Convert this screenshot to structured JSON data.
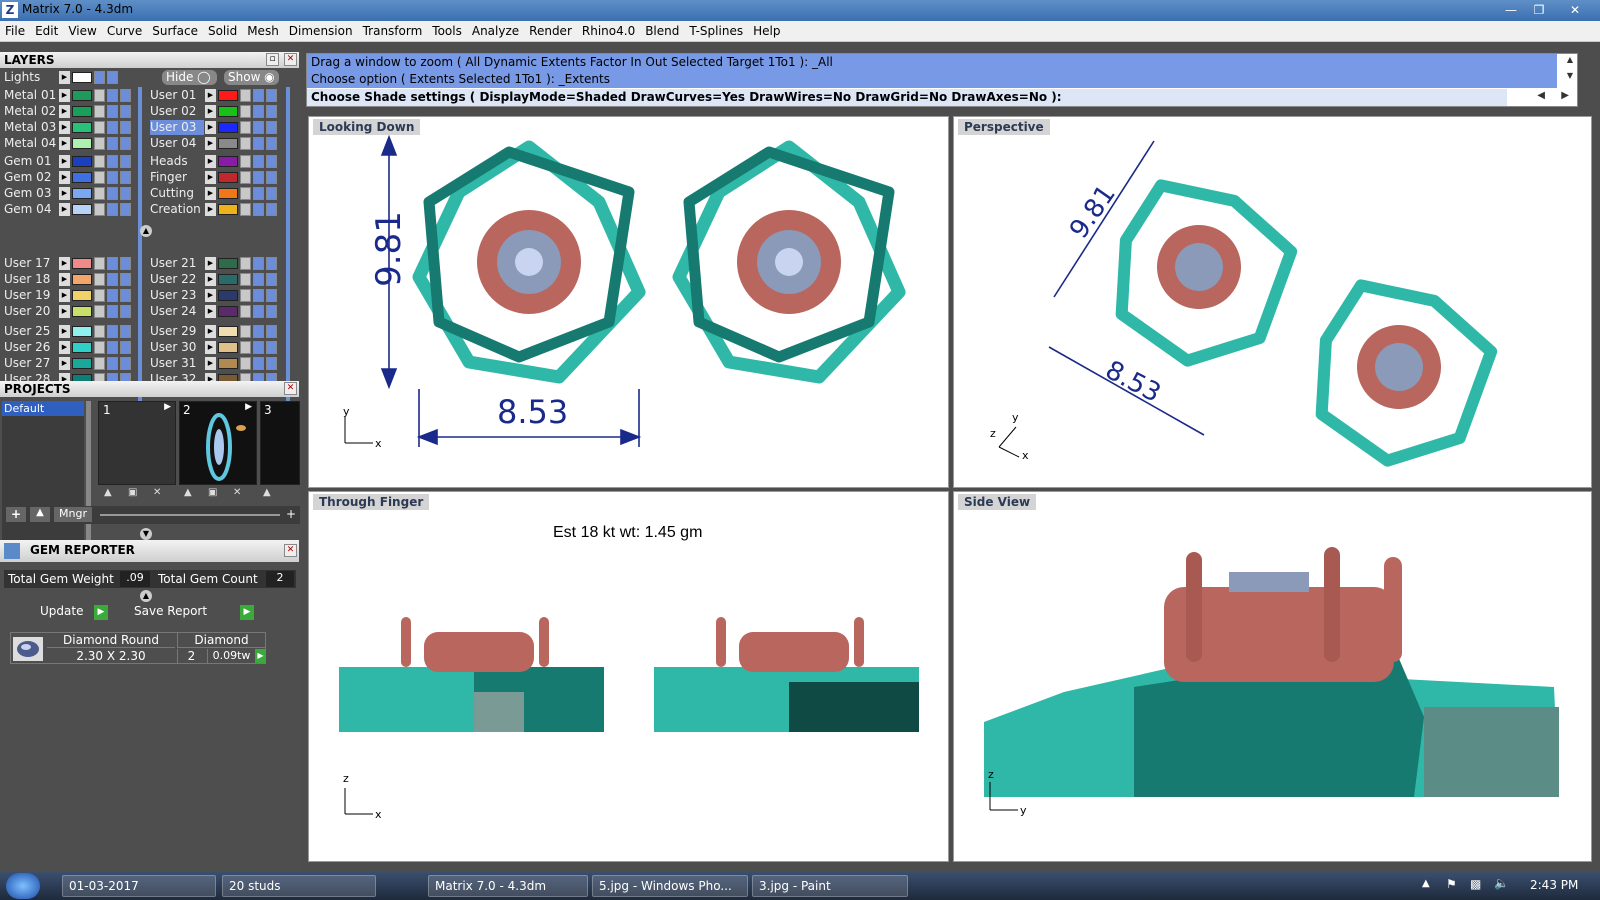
{
  "window": {
    "title": "Matrix 7.0 - 4.3dm",
    "icon_label": "Z"
  },
  "menu": [
    "File",
    "Edit",
    "View",
    "Curve",
    "Surface",
    "Solid",
    "Mesh",
    "Dimension",
    "Transform",
    "Tools",
    "Analyze",
    "Render",
    "Rhino4.0",
    "Blend",
    "T-Splines",
    "Help"
  ],
  "layers": {
    "title": "LAYERS",
    "lights": "Lights",
    "hide": "Hide",
    "show": "Show",
    "left": [
      {
        "label": "Metal 01",
        "color": "#1f9a5c"
      },
      {
        "label": "Metal 02",
        "color": "#1a9f5a"
      },
      {
        "label": "Metal 03",
        "color": "#29c07a"
      },
      {
        "label": "Metal 04",
        "color": "#aef0b0"
      },
      {
        "label": "Gem 01",
        "color": "#1a3fbf"
      },
      {
        "label": "Gem 02",
        "color": "#3f6fe0"
      },
      {
        "label": "Gem 03",
        "color": "#7aa8f0"
      },
      {
        "label": "Gem 04",
        "color": "#b9d3f7"
      },
      {
        "label": "User 17",
        "color": "#ef8a8a"
      },
      {
        "label": "User 18",
        "color": "#f2a66c"
      },
      {
        "label": "User 19",
        "color": "#efd36a"
      },
      {
        "label": "User 20",
        "color": "#c8e06a"
      },
      {
        "label": "User 25",
        "color": "#8ff0ee"
      },
      {
        "label": "User 26",
        "color": "#2fd0c8"
      },
      {
        "label": "User 27",
        "color": "#1aa89a"
      },
      {
        "label": "User 28",
        "color": "#0f7f76"
      }
    ],
    "right": [
      {
        "label": "User 01",
        "color": "#ff1a1a"
      },
      {
        "label": "User 02",
        "color": "#18c018"
      },
      {
        "label": "User 03",
        "color": "#1a2aff"
      },
      {
        "label": "User 04",
        "color": "#8a8a8a"
      },
      {
        "label": "Heads",
        "color": "#8a1aa8"
      },
      {
        "label": "Finger",
        "color": "#c0282d"
      },
      {
        "label": "Cutting",
        "color": "#f07818"
      },
      {
        "label": "Creation",
        "color": "#f0b21a"
      },
      {
        "label": "User 21",
        "color": "#2e6b4a"
      },
      {
        "label": "User 22",
        "color": "#2a6a6a"
      },
      {
        "label": "User 23",
        "color": "#2a3a6a"
      },
      {
        "label": "User 24",
        "color": "#5a2a6a"
      },
      {
        "label": "User 29",
        "color": "#f2ddb0"
      },
      {
        "label": "User 30",
        "color": "#e0c08a"
      },
      {
        "label": "User 31",
        "color": "#b08a50"
      },
      {
        "label": "User 32",
        "color": "#7a5a30"
      }
    ]
  },
  "projects": {
    "title": "PROJECTS",
    "default": "Default",
    "thumbs": [
      "1",
      "2",
      "3"
    ],
    "mngr": "Mngr"
  },
  "gem_reporter": {
    "title": "GEM REPORTER",
    "weight_label": "Total Gem Weight",
    "weight_value": ".09",
    "count_label": "Total Gem Count",
    "count_value": "2",
    "update": "Update",
    "save_report": "Save Report",
    "col1": "Diamond Round",
    "col2": "Diamond",
    "size": "2.30 X 2.30",
    "qty": "2",
    "tw": "0.09tw"
  },
  "command": {
    "line1": "Drag a window to zoom ( All  Dynamic  Extents  Factor  In  Out  Selected  Target  1To1 ): _All",
    "line2": "Choose option ( Extents  Selected  1To1 ): _Extents",
    "line3": "Choose Shade settings ( DisplayMode=Shaded  DrawCurves=Yes  DrawWires=No  DrawGrid=No  DrawAxes=No ):"
  },
  "viewports": {
    "top_left": {
      "label": "Looking Down",
      "dim_v": "9.81",
      "dim_h": "8.53",
      "axis_x": "x",
      "axis_y": "y"
    },
    "top_right": {
      "label": "Perspective",
      "dim_v": "9.81",
      "dim_h": "8.53",
      "axis_x": "x",
      "axis_y": "y",
      "axis_z": "z"
    },
    "bottom_left": {
      "label": "Through Finger",
      "note": "Est 18 kt wt: 1.45 gm",
      "axis_x": "x",
      "axis_z": "z"
    },
    "bottom_right": {
      "label": "Side View",
      "axis_y": "y",
      "axis_z": "z"
    }
  },
  "colors": {
    "teal": "#2fb8a8",
    "teal_dark": "#167a70",
    "gold": "#b8665e",
    "gem": "#8a9ab8",
    "dim_blue": "#1a2a8a",
    "layer_selected": "#6c8dd9"
  },
  "taskbar": {
    "items": [
      "01-03-2017",
      "20 studs",
      "Matrix 7.0 - 4.3dm",
      "5.jpg - Windows Pho...",
      "3.jpg - Paint"
    ],
    "time": "2:43 PM"
  }
}
